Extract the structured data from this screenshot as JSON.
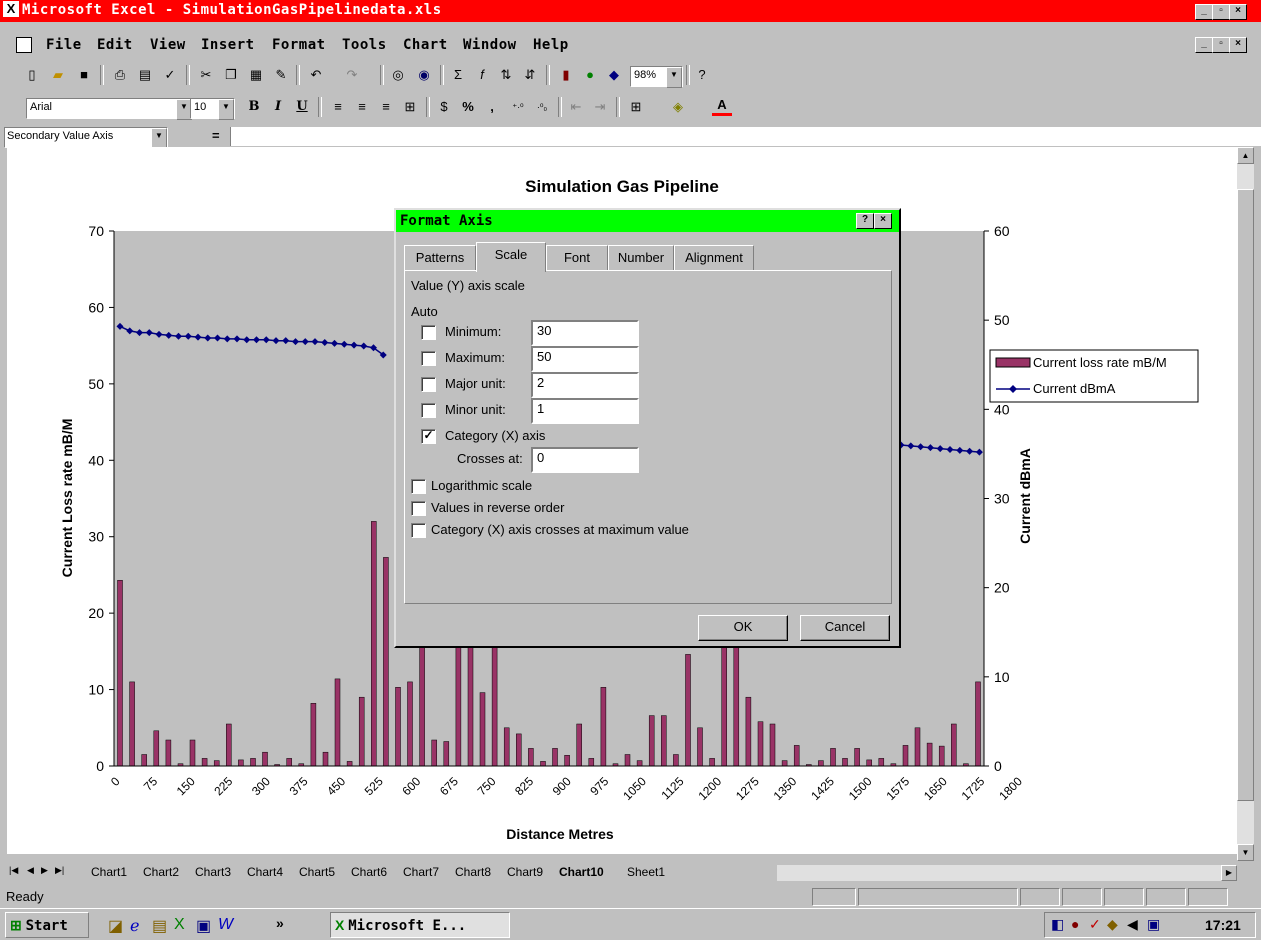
{
  "window": {
    "title": "Microsoft Excel - SimulationGasPipelinedata.xls",
    "controls": [
      "_",
      "▫",
      "×"
    ]
  },
  "menu": [
    "File",
    "Edit",
    "View",
    "Insert",
    "Format",
    "Tools",
    "Chart",
    "Window",
    "Help"
  ],
  "toolbar": {
    "zoom": "98%",
    "font_name": "Arial",
    "font_size": "10",
    "bold": "B",
    "italic": "I",
    "underline": "U",
    "percent": "%",
    "comma": ","
  },
  "formula_bar": {
    "name_box": "Secondary Value Axis",
    "equals": "="
  },
  "chart_data": {
    "type": "bar",
    "title": "Simulation Gas Pipeline",
    "xlabel": "Distance Metres",
    "ylabel": "Current Loss rate mB/M",
    "y2label": "Current dBmA",
    "ylim": [
      0,
      70
    ],
    "y2lim": [
      0,
      60
    ],
    "x_tick_labels": [
      "0",
      "75",
      "150",
      "225",
      "300",
      "375",
      "450",
      "525",
      "600",
      "675",
      "750",
      "825",
      "900",
      "975",
      "1050",
      "1125",
      "1200",
      "1275",
      "1350",
      "1425",
      "1500",
      "1575",
      "1650",
      "1725",
      "1800"
    ],
    "y_tick_labels": [
      "0",
      "10",
      "20",
      "30",
      "40",
      "50",
      "60",
      "70"
    ],
    "y2_tick_labels": [
      "0",
      "10",
      "20",
      "30",
      "40",
      "50",
      "60"
    ],
    "legend_position": "right",
    "series": [
      {
        "name": "Current loss rate mB/M",
        "type": "bar",
        "color": "#993366",
        "values": [
          24.3,
          11.0,
          1.5,
          4.6,
          3.4,
          0.3,
          3.4,
          1.0,
          0.7,
          5.5,
          0.8,
          1.0,
          1.8,
          0.2,
          1.0,
          0.3,
          8.2,
          1.8,
          11.4,
          0.6,
          9.0,
          32.0,
          27.3,
          10.3,
          11.0,
          15.5,
          3.4,
          3.2,
          15.5,
          15.5,
          9.6,
          15.5,
          5.0,
          4.2,
          2.3,
          0.6,
          2.3,
          1.4,
          5.5,
          1.0,
          10.3,
          0.3,
          1.5,
          0.7,
          6.6,
          6.6,
          1.5,
          14.6,
          5.0,
          1.0,
          15.5,
          15.5,
          9.0,
          5.8,
          5.5,
          0.7,
          2.7,
          0.2,
          0.7,
          2.3,
          1.0,
          2.3,
          0.8,
          1.0,
          0.3,
          2.7,
          5.0,
          3.0,
          2.6,
          5.5,
          0.3,
          11.0
        ]
      },
      {
        "name": "Current dBmA",
        "type": "line",
        "color": "#000080",
        "values": [
          49.3,
          48.8,
          48.6,
          48.6,
          48.4,
          48.3,
          48.2,
          48.2,
          48.1,
          48.0,
          48.0,
          47.9,
          47.9,
          47.8,
          47.8,
          47.8,
          47.7,
          47.7,
          47.6,
          47.6,
          47.6,
          47.5,
          47.4,
          47.3,
          47.2,
          47.1,
          46.9,
          46.1
        ]
      },
      {
        "name": "Current dBmA (right segment)",
        "type": "line",
        "color": "#000080",
        "values": [
          36.6,
          36.5,
          36.4,
          36.3,
          36.2,
          36.0,
          35.9,
          35.8,
          35.7,
          35.6,
          35.5,
          35.4,
          35.3,
          35.2
        ]
      }
    ]
  },
  "dialog": {
    "title": "Format Axis",
    "help_button": "?",
    "close_button": "×",
    "tabs": [
      "Patterns",
      "Scale",
      "Font",
      "Number",
      "Alignment"
    ],
    "active_tab": "Scale",
    "heading": "Value (Y) axis scale",
    "auto_label": "Auto",
    "minimum_label": "Minimum:",
    "minimum_value": "30",
    "maximum_label": "Maximum:",
    "maximum_value": "50",
    "major_unit_label": "Major unit:",
    "major_unit_value": "2",
    "minor_unit_label": "Minor unit:",
    "minor_unit_value": "1",
    "category_axis_label": "Category (X) axis",
    "category_axis_checked": true,
    "crosses_at_label": "Crosses at:",
    "crosses_at_value": "0",
    "logarithmic_label": "Logarithmic scale",
    "reverse_label": "Values in reverse order",
    "crosses_max_label": "Category (X) axis crosses at maximum value",
    "ok": "OK",
    "cancel": "Cancel"
  },
  "sheet_tabs": [
    "Chart1",
    "Chart2",
    "Chart3",
    "Chart4",
    "Chart5",
    "Chart6",
    "Chart7",
    "Chart8",
    "Chart9",
    "Chart10",
    "Sheet1"
  ],
  "active_sheet": "Chart10",
  "status": "Ready",
  "taskbar": {
    "start": "Start",
    "task": "Microsoft E...",
    "clock": "17:21",
    "chevron": "»"
  }
}
